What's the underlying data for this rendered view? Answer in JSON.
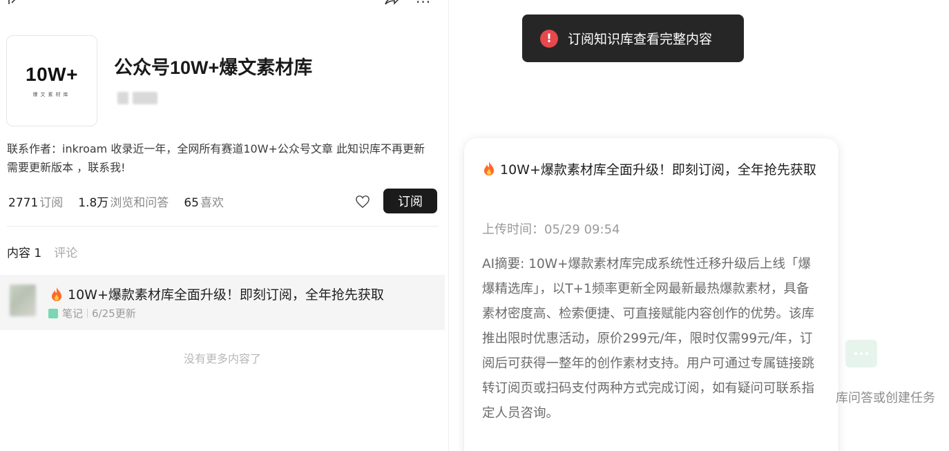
{
  "left": {
    "cover": {
      "big_text": "10W+",
      "small_text": "爆文素材库"
    },
    "title": "公众号10W+爆文素材库",
    "description": "联系作者：inkroam 收录近一年，全网所有赛道10W+公众号文章 此知识库不再更新 需要更新版本 ，联系我!",
    "stats": [
      {
        "num": "2771",
        "label": "订阅"
      },
      {
        "num": "1.8万",
        "label": "浏览和问答"
      },
      {
        "num": "65",
        "label": "喜欢"
      }
    ],
    "subscribe_label": "订阅",
    "tabs": {
      "content": "内容 1",
      "comments": "评论"
    },
    "doc": {
      "title": "10W+爆款素材库全面升级！即刻订阅，全年抢先获取",
      "type": "笔记",
      "updated": "6/25更新"
    },
    "no_more": "没有更多内容了"
  },
  "right": {
    "toast": {
      "icon": "!",
      "text": "订阅知识库查看完整内容"
    },
    "card": {
      "title": "10W+爆款素材库全面升级！即刻订阅，全年抢先获取",
      "upload_time": "上传时间：05/29 09:54",
      "summary": "AI摘要: 10W+爆款素材库完成系统性迁移升级后上线「爆爆精选库」，以T+1频率更新全网最新最热爆款素材，具备素材密度高、检索便捷、可直接赋能内容创作的优势。该库推出限时优惠活动，原价299元/年，限时仅需99元/年，订阅后可获得一整年的创作素材支持。用户可通过专属链接跳转订阅页或扫码支付两种方式完成订阅，如有疑问可联系指定人员咨询。"
    },
    "hint": "库问答或创建任务"
  },
  "colors": {
    "toast_bg": "#262626",
    "alert_red": "#e5484d",
    "button_bg": "#1b1b1b",
    "note_green": "#7ad6b4"
  }
}
